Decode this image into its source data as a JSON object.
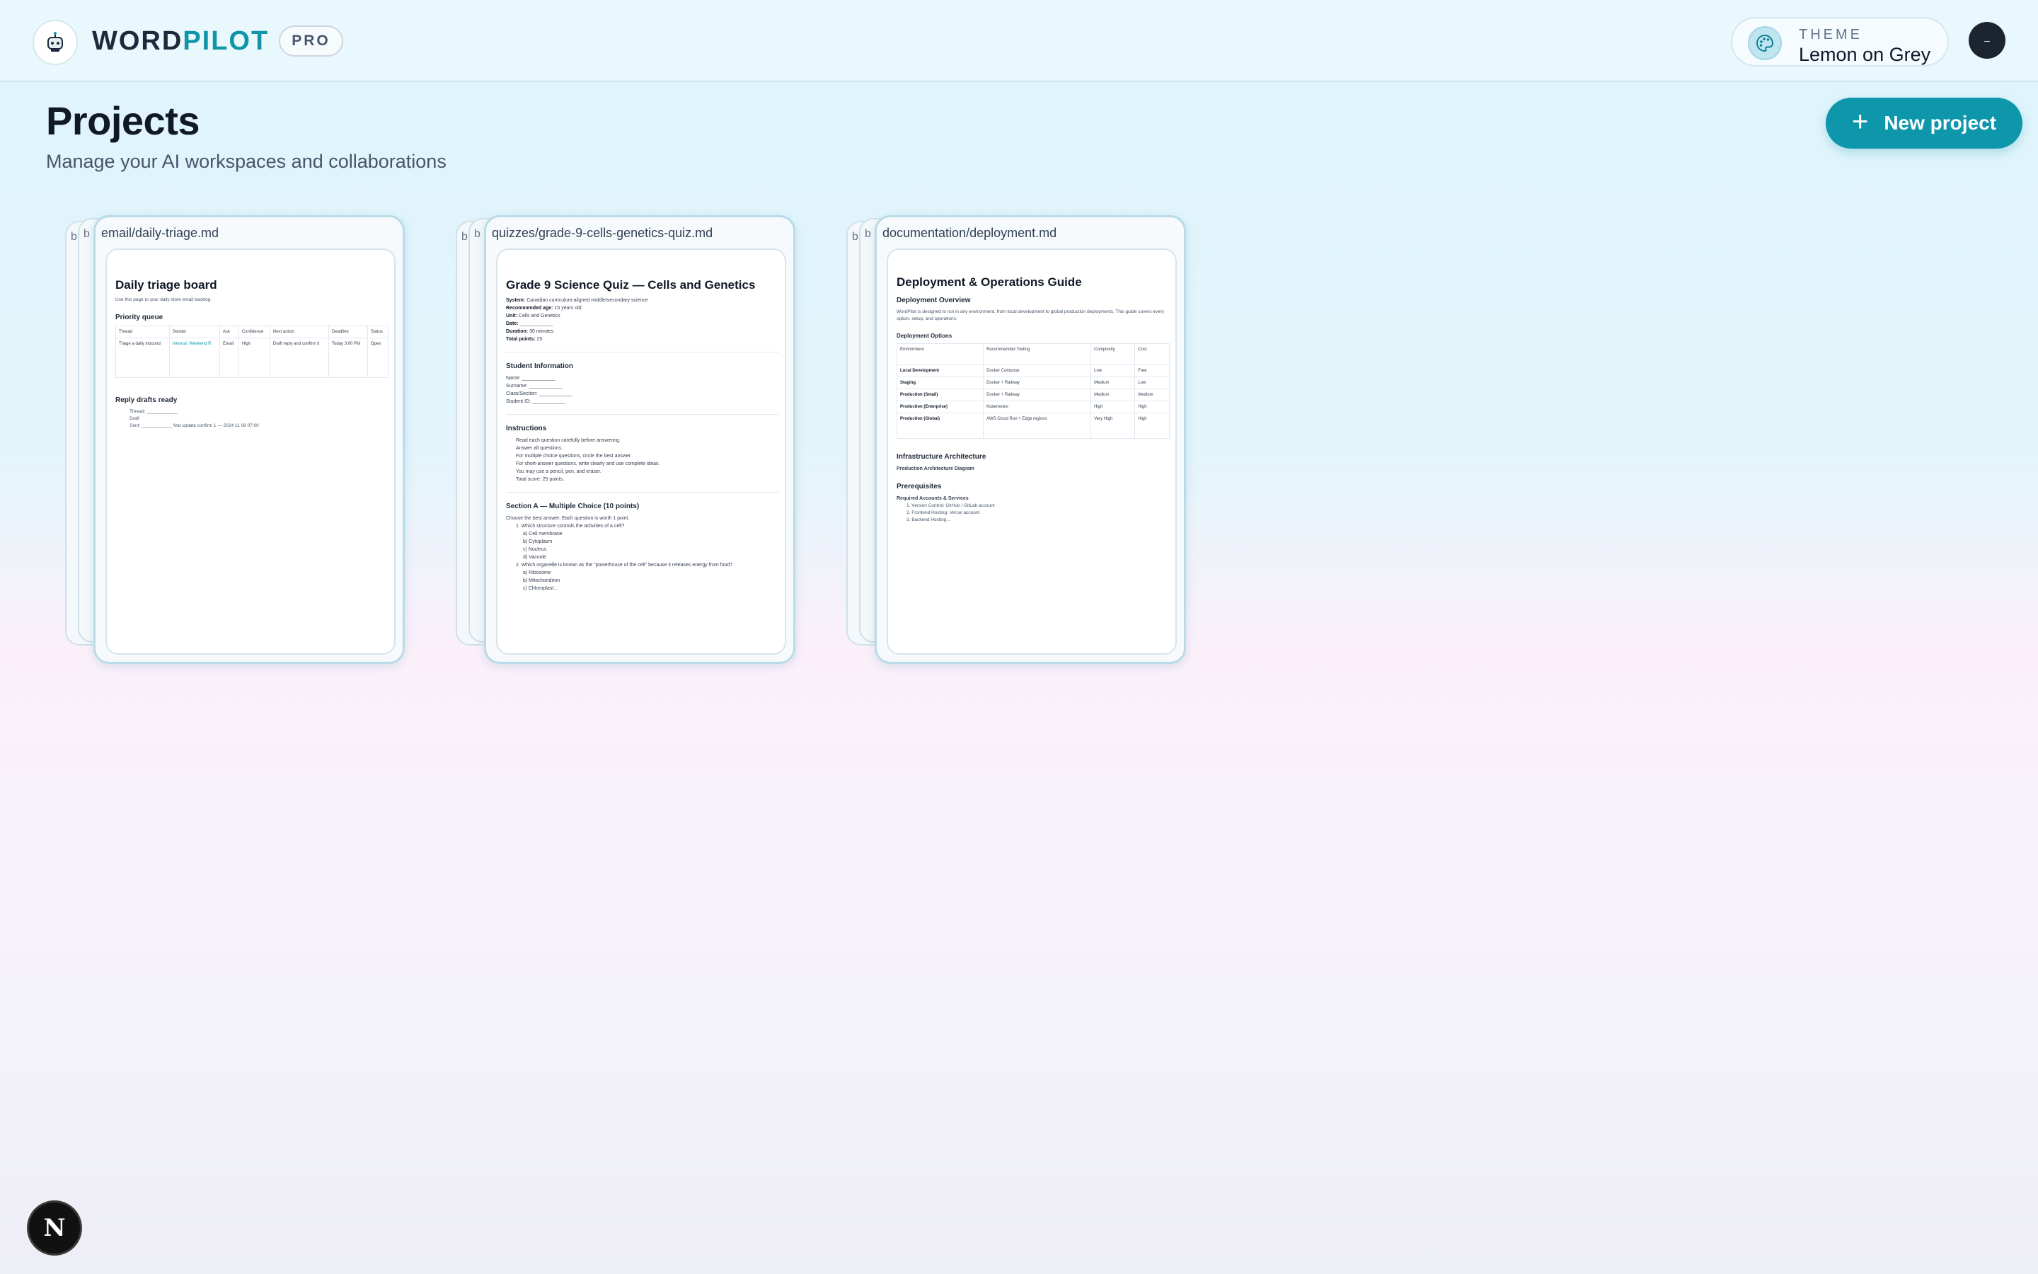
{
  "header": {
    "brand_part1": "WORD",
    "brand_part2": "PILOT",
    "badge": "PRO",
    "theme_label": "THEME",
    "theme_value": "Lemon on Grey",
    "avatar_text": "–"
  },
  "page": {
    "title": "Projects",
    "subtitle": "Manage your AI workspaces and collaborations",
    "new_project_label": "New project",
    "new_project_icon": "+"
  },
  "projects": [
    {
      "stack_tabs": [
        "b",
        "b"
      ],
      "path": "email/daily-triage.md",
      "doc_title": "Daily triage board",
      "doc_intro": "Use this page to your daily store email backlog.",
      "section1": "Priority queue",
      "table_head": [
        "Thread",
        "Sender",
        "Ask",
        "Confidence",
        "Next action",
        "Deadline",
        "Status"
      ],
      "table_row": [
        "Triage a daily inbound",
        "Internal: Weekend R",
        "Email",
        "High",
        "Draft reply and confirm it",
        "Today 3:00 PM",
        "Open"
      ],
      "section2": "Reply drafts ready",
      "draft_lines": [
        "Thread: ____________",
        "Draft",
        "Sent: ____________ fwd update confirm 1 — 2024 11 08 07:00"
      ]
    },
    {
      "stack_tabs": [
        "b",
        "b"
      ],
      "path": "quizzes/grade-9-cells-genetics-quiz.md",
      "doc_title": "Grade 9 Science Quiz — Cells and Genetics",
      "meta": [
        {
          "k": "System:",
          "v": "Canadian curriculum-aligned middle/secondary science"
        },
        {
          "k": "Recommended age:",
          "v": "15 years old"
        },
        {
          "k": "Unit:",
          "v": "Cells and Genetics"
        },
        {
          "k": "Date:",
          "v": "____________"
        },
        {
          "k": "Duration:",
          "v": "30 minutes"
        },
        {
          "k": "Total points:",
          "v": "25"
        }
      ],
      "section1": "Student Information",
      "student_fields": [
        "Name: ____________",
        "Surname: ____________",
        "Class/Section: ____________",
        "Student ID: ____________"
      ],
      "section2": "Instructions",
      "instructions": [
        "Read each question carefully before answering.",
        "Answer all questions.",
        "For multiple choice questions, circle the best answer.",
        "For short-answer questions, write clearly and use complete ideas.",
        "You may use a pencil, pen, and eraser.",
        "Total score: 25 points."
      ],
      "section3": "Section A — Multiple Choice (10 points)",
      "section3_intro": "Choose the best answer. Each question is worth 1 point.",
      "questions": [
        "1. Which structure controls the activities of a cell?",
        "a) Cell membrane",
        "b) Cytoplasm",
        "c) Nucleus",
        "d) Vacuole",
        "2. Which organelle is known as the \"powerhouse of the cell\" because it releases energy from food?",
        "a) Ribosome",
        "b) Mitochondrion",
        "c) Chloroplast..."
      ]
    },
    {
      "stack_tabs": [
        "b",
        "b"
      ],
      "path": "documentation/deployment.md",
      "doc_title": "Deployment & Operations Guide",
      "section1": "Deployment Overview",
      "overview_text": "WordPilot is designed to run in any environment, from local development to global production deployments. This guide covers every option, setup, and operations.",
      "section2": "Deployment Options",
      "table_head": [
        "Environment",
        "Recommended Tooling",
        "Complexity",
        "Cost"
      ],
      "table_rows": [
        [
          "Local Development",
          "Docker Compose",
          "Low",
          "Free"
        ],
        [
          "Staging",
          "Docker + Railway",
          "Medium",
          "Low"
        ],
        [
          "Production (Small)",
          "Docker + Railway",
          "Medium",
          "Medium"
        ],
        [
          "Production (Enterprise)",
          "Kubernetes",
          "High",
          "High"
        ],
        [
          "Production (Global)",
          "AWS Cloud Run + Edge regions",
          "Very High",
          "High"
        ]
      ],
      "section3": "Infrastructure Architecture",
      "section3_sub": "Production Architecture Diagram",
      "section4": "Prerequisites",
      "section4_sub": "Required Accounts & Services",
      "prereq": [
        "1. Version Control: GitHub / GitLab account",
        "2. Frontend Hosting: Vercel account",
        "3. Backend Hosting..."
      ]
    }
  ],
  "footer": {
    "badge_letter": "N"
  }
}
